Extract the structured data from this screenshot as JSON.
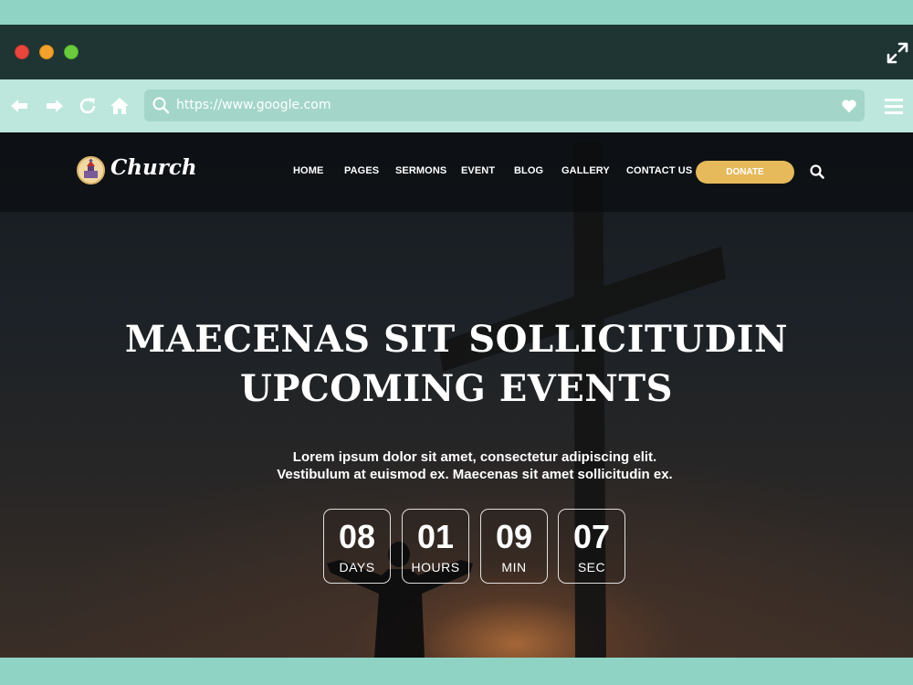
{
  "browser": {
    "url": "https://www.google.com"
  },
  "site": {
    "logo_text": "Church",
    "nav": {
      "items": [
        "HOME",
        "PAGES",
        "SERMONS",
        "EVENT",
        "BLOG",
        "GALLERY",
        "CONTACT US"
      ],
      "donate_label": "DONATE"
    },
    "hero": {
      "headline_line1": "MAECENAS SIT SOLLICITUDIN",
      "headline_line2": "UPCOMING EVENTS",
      "subtext": "Lorem ipsum dolor sit amet, consectetur adipiscing elit. Vestibulum at euismod ex. Maecenas sit amet sollicitudin ex."
    },
    "countdown": [
      {
        "value": "08",
        "label": "DAYS"
      },
      {
        "value": "01",
        "label": "HOURS"
      },
      {
        "value": "09",
        "label": "MIN"
      },
      {
        "value": "07",
        "label": "SEC"
      }
    ]
  },
  "colors": {
    "page_bg": "#8fd3c4",
    "titlebar": "#1f3533",
    "toolbar": "#bde7dc",
    "urlbar": "#a3d6c9",
    "donate": "#e6b95a"
  },
  "icons": [
    "back-arrow-icon",
    "forward-arrow-icon",
    "refresh-icon",
    "home-icon",
    "search-icon",
    "heart-icon",
    "hamburger-menu-icon",
    "expand-icon",
    "church-logo-icon"
  ]
}
